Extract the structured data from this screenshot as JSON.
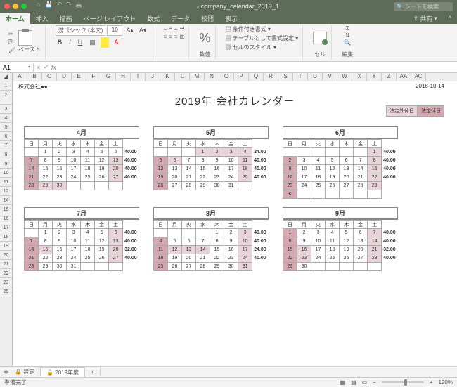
{
  "titlebar": {
    "filename": "company_calendar_2019_1",
    "search_ph": "シートを検索"
  },
  "tabs": [
    "ホーム",
    "挿入",
    "描画",
    "ページ レイアウト",
    "数式",
    "データ",
    "校閲",
    "表示"
  ],
  "share": "共有",
  "ribbon": {
    "paste": "ペースト",
    "font": "游ゴシック (本文)",
    "size": "10",
    "num_grp": "数値",
    "fmt1": "条件付き書式",
    "fmt2": "テーブルとして書式設定",
    "fmt3": "セルのスタイル",
    "cell_grp": "セル",
    "edit_grp": "編集"
  },
  "namebox": "A1",
  "cols": [
    "A",
    "B",
    "C",
    "D",
    "E",
    "F",
    "G",
    "H",
    "I",
    "J",
    "K",
    "L",
    "M",
    "N",
    "O",
    "P",
    "Q",
    "R",
    "S",
    "T",
    "U",
    "V",
    "W",
    "X",
    "Y",
    "Z",
    "AA",
    "AC"
  ],
  "rows": [
    "1",
    "2",
    "3",
    "4",
    "5",
    "6",
    "7",
    "8",
    "9",
    "10",
    "11",
    "12",
    "14",
    "15",
    "16",
    "17",
    "18",
    "19",
    "20",
    "21",
    "22",
    "23",
    "25"
  ],
  "doc": {
    "company": "株式会社●●",
    "date": "2018-10-14",
    "title": "2019年 会社カレンダー",
    "leg1": "法定外休日",
    "leg2": "法定休日"
  },
  "dow": [
    "日",
    "月",
    "火",
    "水",
    "木",
    "金",
    "土"
  ],
  "months": [
    {
      "name": "4月",
      "start": 1,
      "days": 30,
      "hours": [
        "40.00",
        "40.00",
        "40.00",
        "40.00",
        ""
      ],
      "hl": {
        "7": 2,
        "13": 1,
        "14": 2,
        "20": 1,
        "21": 2,
        "27": 1,
        "28": 2,
        "29": 1,
        "30": 1
      }
    },
    {
      "name": "5月",
      "start": 3,
      "days": 31,
      "hours": [
        "24.00",
        "40.00",
        "40.00",
        "40.00",
        ""
      ],
      "hl": {
        "1": 1,
        "2": 1,
        "3": 1,
        "4": 1,
        "5": 2,
        "6": 1,
        "11": 1,
        "12": 2,
        "18": 1,
        "19": 2,
        "25": 1,
        "26": 2
      }
    },
    {
      "name": "6月",
      "start": 6,
      "days": 30,
      "hours": [
        "40.00",
        "40.00",
        "40.00",
        "40.00",
        ""
      ],
      "hl": {
        "1": 1,
        "2": 2,
        "8": 1,
        "9": 2,
        "15": 1,
        "16": 2,
        "22": 1,
        "23": 2,
        "29": 1,
        "30": 2
      }
    },
    {
      "name": "7月",
      "start": 1,
      "days": 31,
      "hours": [
        "40.00",
        "40.00",
        "32.00",
        "40.00",
        ""
      ],
      "hl": {
        "6": 1,
        "7": 2,
        "13": 1,
        "14": 2,
        "15": 1,
        "20": 1,
        "21": 2,
        "27": 1,
        "28": 2
      }
    },
    {
      "name": "8月",
      "start": 4,
      "days": 31,
      "hours": [
        "40.00",
        "40.00",
        "24.00",
        "40.00",
        ""
      ],
      "hl": {
        "3": 1,
        "4": 2,
        "10": 1,
        "11": 2,
        "12": 1,
        "13": 1,
        "14": 1,
        "17": 1,
        "18": 2,
        "24": 1,
        "25": 2,
        "31": 1
      }
    },
    {
      "name": "9月",
      "start": 0,
      "days": 30,
      "hours": [
        "40.00",
        "40.00",
        "32.00",
        "40.00",
        ""
      ],
      "hl": {
        "1": 2,
        "7": 1,
        "8": 2,
        "14": 1,
        "15": 2,
        "16": 1,
        "21": 1,
        "22": 2,
        "23": 1,
        "28": 1,
        "29": 2
      }
    }
  ],
  "sheets": {
    "s1": "設定",
    "s2": "2019年度"
  },
  "status": {
    "ready": "準備完了",
    "zoom": "120%"
  }
}
